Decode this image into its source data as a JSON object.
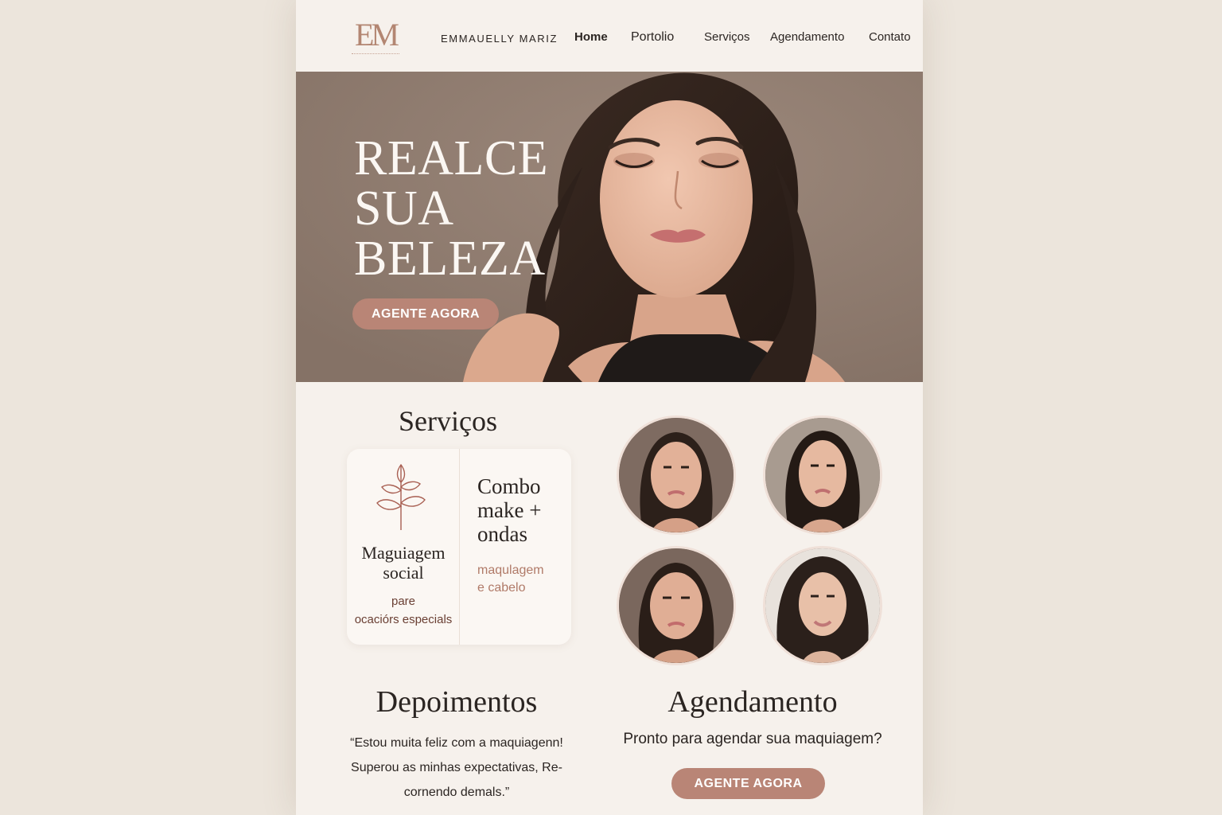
{
  "header": {
    "logo": "EM",
    "brand": "EMMAUELLY MARIZ",
    "nav": [
      "Home",
      "Portolio",
      "Serviços",
      "Agendamento",
      "Contato"
    ]
  },
  "hero": {
    "title_lines": [
      "REALCE",
      "SUA",
      "BELEZA"
    ],
    "cta": "AGENTE AGORA"
  },
  "services": {
    "title": "Serviços",
    "items": [
      {
        "name_lines": [
          "Maguiagem",
          "social"
        ],
        "desc_lines": [
          "pare",
          "ocaciórs especials"
        ],
        "icon": "leaf-icon"
      },
      {
        "name_lines": [
          "Combo",
          "make +",
          "ondas"
        ],
        "desc_lines": [
          "maqulagem",
          "e cabelo"
        ]
      }
    ]
  },
  "testimonials": {
    "title": "Depoimentos",
    "quote_lines": [
      "“Estou muita feliz com a maquiagenn!",
      "Superou as minhas expectativas, Re-",
      "cornendo demals.”"
    ]
  },
  "booking": {
    "title": "Agendamento",
    "text": "Pronto para agendar sua maquiagem?",
    "cta": "AGENTE AGORA"
  },
  "colors": {
    "accent": "#b98576",
    "background": "#f6f1ec",
    "hero_bg": "#8f7b6f",
    "text": "#2b2522"
  }
}
